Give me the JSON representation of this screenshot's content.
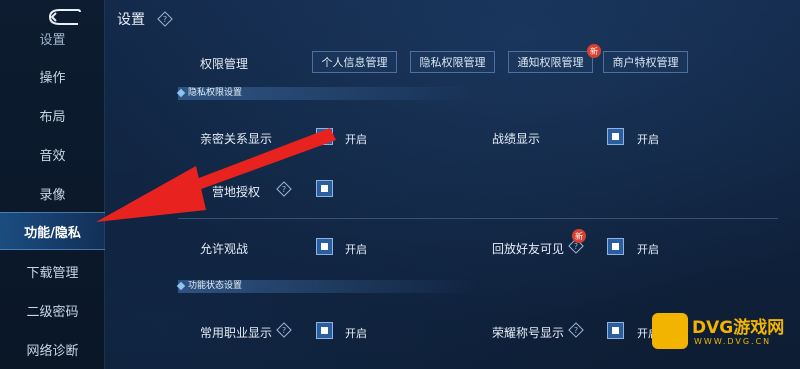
{
  "header": {
    "title": "设置"
  },
  "sidebar": {
    "items": [
      {
        "label": "操作"
      },
      {
        "label": "布局"
      },
      {
        "label": "音效"
      },
      {
        "label": "录像"
      },
      {
        "label": "功能/隐私"
      },
      {
        "label": "下载管理"
      },
      {
        "label": "二级密码"
      },
      {
        "label": "网络诊断"
      }
    ],
    "partial_label": "设置"
  },
  "permissions": {
    "label": "权限管理",
    "tabs": [
      {
        "label": "个人信息管理"
      },
      {
        "label": "隐私权限管理"
      },
      {
        "label": "通知权限管理",
        "badge": "新"
      },
      {
        "label": "商户特权管理"
      }
    ]
  },
  "privacy_section": {
    "title": "隐私权限设置",
    "rows": [
      {
        "label": "亲密关系显示",
        "state": "开启"
      },
      {
        "label": "战绩显示",
        "state": "开启"
      },
      {
        "label": "营地授权"
      },
      {
        "label": "允许观战",
        "state": "开启"
      },
      {
        "label": "回放好友可见",
        "state": "开启",
        "badge": "新"
      }
    ]
  },
  "function_section": {
    "title": "功能状态设置",
    "rows": [
      {
        "label": "常用职业显示",
        "state": "开启"
      },
      {
        "label": "荣耀称号显示",
        "state": "开启"
      }
    ]
  },
  "watermark": {
    "brand": "DVG游戏网",
    "url": "WWW.DVG.CN"
  },
  "colors": {
    "accent": "#2a5ea0",
    "arrow": "#e8231f",
    "badge": "#d8412f",
    "logo": "#f3b400"
  }
}
